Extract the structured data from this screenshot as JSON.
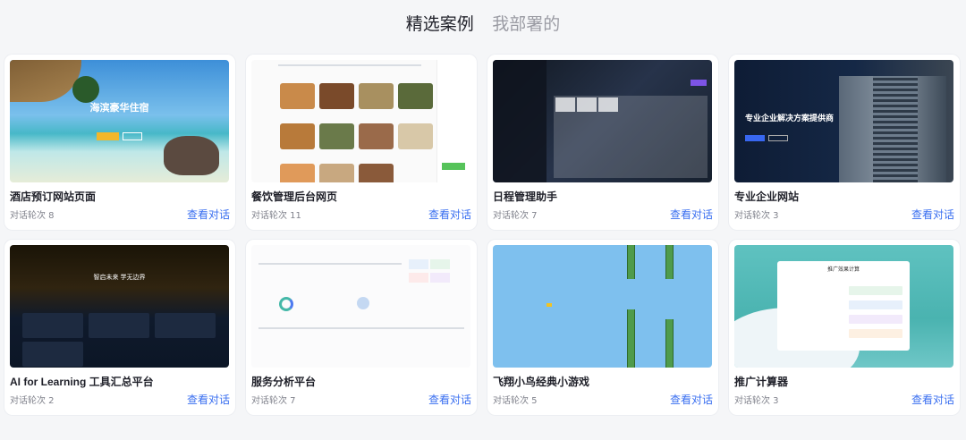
{
  "tabs": [
    {
      "label": "精选案例",
      "active": true
    },
    {
      "label": "我部署的",
      "active": false
    }
  ],
  "colors": {
    "accent": "#3a6ff0",
    "active_tab": "#1f2029",
    "inactive_tab": "#9a9ba3"
  },
  "cards": [
    {
      "title": "酒店预订网站页面",
      "meta": "对话轮次 8",
      "link": "查看对话",
      "thumb": {
        "line1": "海滨豪华住宿"
      }
    },
    {
      "title": "餐饮管理后台网页",
      "meta": "对话轮次 11",
      "link": "查看对话"
    },
    {
      "title": "日程管理助手",
      "meta": "对话轮次 7",
      "link": "查看对话"
    },
    {
      "title": "专业企业网站",
      "meta": "对话轮次 3",
      "link": "查看对话",
      "thumb": {
        "line1": "专业企业解决方案提供商"
      }
    },
    {
      "title": "AI for Learning 工具汇总平台",
      "meta": "对话轮次 2",
      "link": "查看对话",
      "thumb": {
        "line1": "智启未来 学无边界"
      }
    },
    {
      "title": "服务分析平台",
      "meta": "对话轮次 7",
      "link": "查看对话"
    },
    {
      "title": "飞翔小鸟经典小游戏",
      "meta": "对话轮次 5",
      "link": "查看对话"
    },
    {
      "title": "推广计算器",
      "meta": "对话轮次 3",
      "link": "查看对话",
      "thumb": {
        "line1": "推广效果计算"
      }
    }
  ]
}
